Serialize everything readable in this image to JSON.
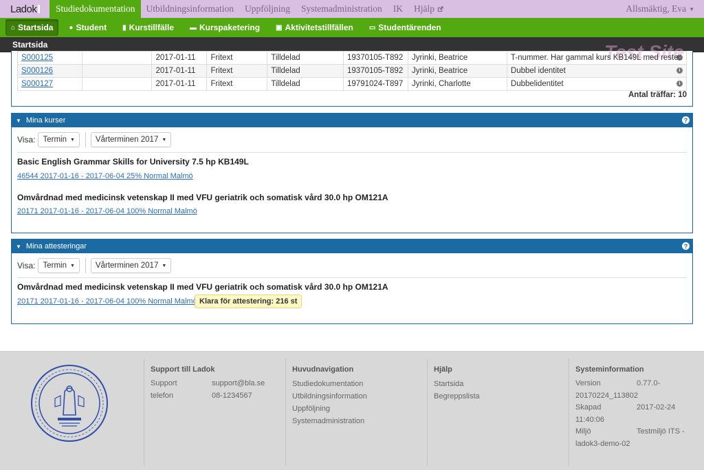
{
  "topnav": {
    "logo": "Ladok",
    "items": [
      "Studiedokumentation",
      "Utbildningsinformation",
      "Uppföljning",
      "Systemadministration",
      "IK",
      "Hjälp"
    ],
    "user": "Allsmäktig, Eva"
  },
  "subnav": {
    "items": [
      "Startsida",
      "Student",
      "Kurstillfälle",
      "Kurspaketering",
      "Aktivitetstillfällen",
      "Studentärenden"
    ]
  },
  "page_title": "Startsida",
  "watermark": "Test Site",
  "tasks_table": {
    "rows": [
      [
        "S000125",
        "",
        "2017-01-11",
        "Fritext",
        "Tilldelad",
        "19370105-T892",
        "Jyrinki, Beatrice",
        "T-nummer. Har gammal kurs KB149L med rester."
      ],
      [
        "S000126",
        "",
        "2017-01-11",
        "Fritext",
        "Tilldelad",
        "19370105-T892",
        "Jyrinki, Beatrice",
        "Dubbel identitet"
      ],
      [
        "S000127",
        "",
        "2017-01-11",
        "Fritext",
        "Tilldelad",
        "19791024-T897",
        "Jyrinki, Charlotte",
        "Dubbelidentitet"
      ]
    ],
    "hits": "Antal träffar: 10"
  },
  "mina_kurser": {
    "title": "Mina kurser",
    "filter_label": "Visa:",
    "filter_type": "Termin",
    "filter_term": "Vårterminen 2017",
    "courses": [
      {
        "title": "Basic English Grammar Skills for University 7.5 hp KB149L",
        "link": "46544 2017-01-16 - 2017-06-04 25% Normal Malmö"
      },
      {
        "title": "Omvårdnad med medicinsk vetenskap II med VFU geriatrik och somatisk vård 30.0 hp OM121A",
        "link": "20171 2017-01-16 - 2017-06-04 100% Normal Malmö"
      }
    ]
  },
  "mina_attesteringar": {
    "title": "Mina attesteringar",
    "filter_label": "Visa:",
    "filter_type": "Termin",
    "filter_term": "Vårterminen 2017",
    "course_title": "Omvårdnad med medicinsk vetenskap II med VFU geriatrik och somatisk vård 30.0 hp OM121A",
    "course_link": "20171 2017-01-16 - 2017-06-04 100% Normal Malmö",
    "badge": "Klara för attestering: 216 st"
  },
  "footer": {
    "support": {
      "title": "Support till Ladok",
      "rows": [
        [
          "Support",
          "support@bla.se"
        ],
        [
          "telefon",
          "08-1234567"
        ]
      ]
    },
    "huvudnavigation": {
      "title": "Huvudnavigation",
      "links": [
        "Studiedokumentation",
        "Utbildningsinformation",
        "Uppföljning",
        "Systemadministration"
      ]
    },
    "hjalp": {
      "title": "Hjälp",
      "links": [
        "Startsida",
        "Begreppslista"
      ]
    },
    "systeminformation": {
      "title": "Systeminformation",
      "rows": [
        [
          "Version",
          "0.77.0-"
        ],
        [
          "",
          "20170224_113802"
        ],
        [
          "Skapad",
          "2017-02-24"
        ],
        [
          "",
          "11:40:06"
        ],
        [
          "Miljö",
          "Testmiljö ITS -"
        ],
        [
          "",
          "ladok3-demo-02"
        ]
      ]
    }
  },
  "colors": {
    "green": "#53a910",
    "purple": "#d9bfe2",
    "blue": "#1c6aa3",
    "dark": "#333333"
  }
}
